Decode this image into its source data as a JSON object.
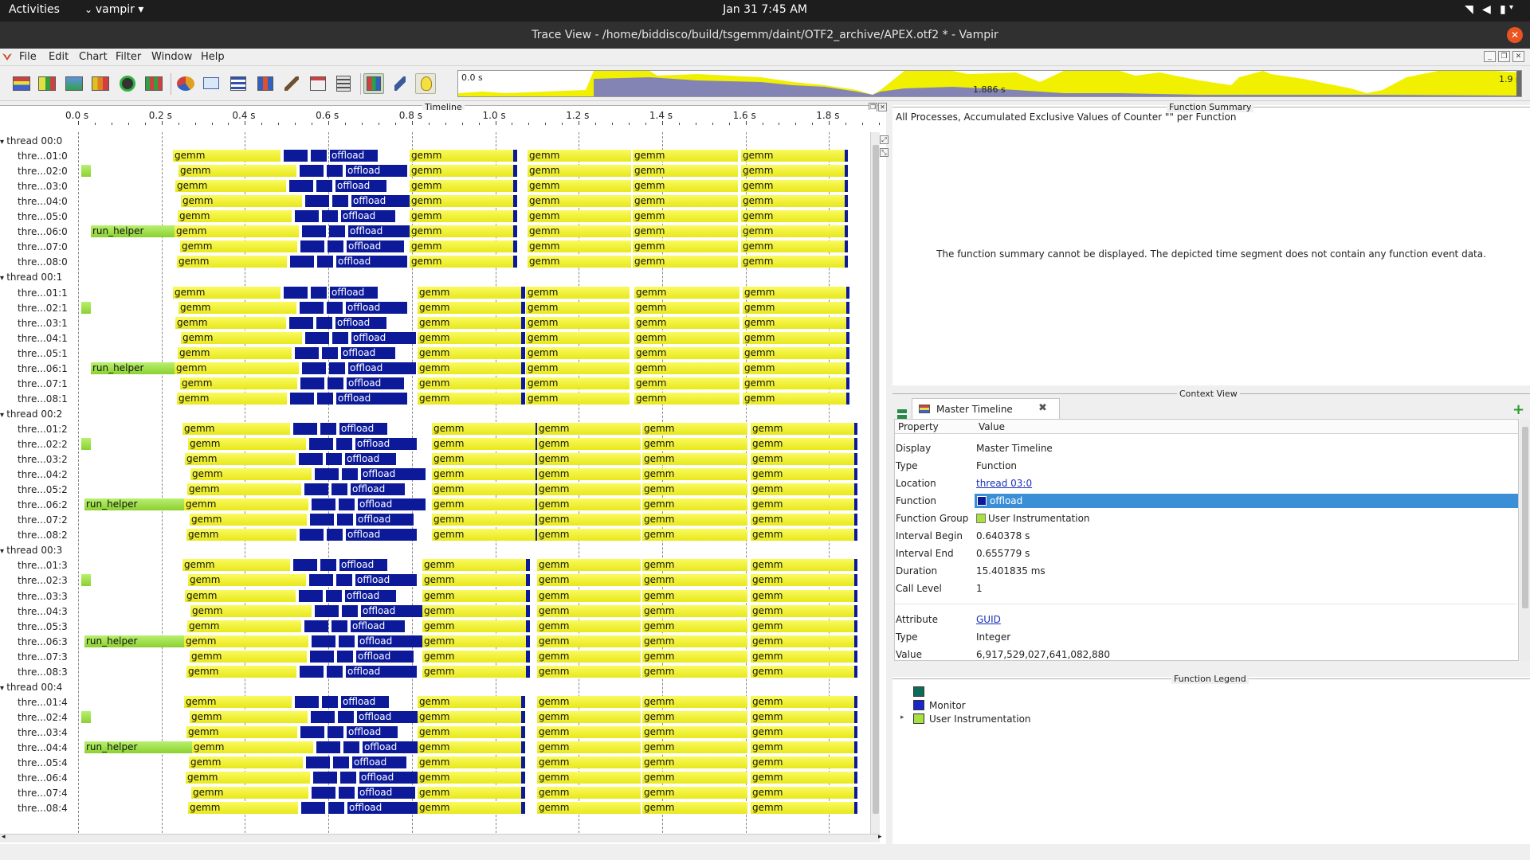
{
  "system_bar": {
    "activities": "Activities",
    "app_menu": "vampir",
    "clock": "Jan 31   7:45 AM"
  },
  "window": {
    "title": "Trace View - /home/biddisco/build/tsgemm/daint/OTF2_archive/APEX.otf2 * - Vampir"
  },
  "menu": [
    "File",
    "Edit",
    "Chart",
    "Filter",
    "Window",
    "Help"
  ],
  "overview": {
    "start": "0.0 s",
    "middle": "1.886 s",
    "end": "1.9 s"
  },
  "timeline": {
    "title": "Timeline",
    "ticks": [
      "0.0 s",
      "0.2 s",
      "0.4 s",
      "0.6 s",
      "0.8 s",
      "1.0 s",
      "1.2 s",
      "1.4 s",
      "1.6 s",
      "1.8 s"
    ],
    "groups": [
      {
        "name": "thread 00:0",
        "rows": [
          "thre...01:0",
          "thre...02:0",
          "thre...03:0",
          "thre...04:0",
          "thre...05:0",
          "thre...06:0",
          "thre...07:0",
          "thre...08:0"
        ]
      },
      {
        "name": "thread 00:1",
        "rows": [
          "thre...01:1",
          "thre...02:1",
          "thre...03:1",
          "thre...04:1",
          "thre...05:1",
          "thre...06:1",
          "thre...07:1",
          "thre...08:1"
        ]
      },
      {
        "name": "thread 00:2",
        "rows": [
          "thre...01:2",
          "thre...02:2",
          "thre...03:2",
          "thre...04:2",
          "thre...05:2",
          "thre...06:2",
          "thre...07:2",
          "thre...08:2"
        ]
      },
      {
        "name": "thread 00:3",
        "rows": [
          "thre...01:3",
          "thre...02:3",
          "thre...03:3",
          "thre...04:3",
          "thre...05:3",
          "thre...06:3",
          "thre...07:3",
          "thre...08:3"
        ]
      },
      {
        "name": "thread 00:4",
        "rows": [
          "thre...01:4",
          "thre...02:4",
          "thre...03:4",
          "thre...04:4",
          "thre...05:4",
          "thre...06:4",
          "thre...07:4",
          "thre...08:4"
        ]
      }
    ],
    "labels": {
      "gemm": "gemm",
      "offload": "offload",
      "run_helper": "run_helper"
    }
  },
  "function_summary": {
    "title": "Function Summary",
    "subtitle": "All Processes, Accumulated Exclusive Values of Counter \"\" per Function",
    "message": "The function summary cannot be displayed. The depicted time segment does not contain any function event data."
  },
  "context_view": {
    "title": "Context View",
    "tab": "Master Timeline",
    "headers": [
      "Property",
      "Value"
    ],
    "rows": [
      {
        "property": "Display",
        "value": "Master Timeline"
      },
      {
        "property": "Type",
        "value": "Function"
      },
      {
        "property": "Location",
        "value": "thread 03:0"
      },
      {
        "property": "Function",
        "value": "offload"
      },
      {
        "property": "Function Group",
        "value": "User Instrumentation"
      },
      {
        "property": "Interval Begin",
        "value": "0.640378 s"
      },
      {
        "property": "Interval End",
        "value": "0.655779 s"
      },
      {
        "property": "Duration",
        "value": "15.401835 ms"
      },
      {
        "property": "Call Level",
        "value": "1"
      }
    ],
    "attr_rows": [
      {
        "property": "Attribute",
        "value": "GUID"
      },
      {
        "property": "Type",
        "value": "Integer"
      },
      {
        "property": "Value",
        "value": "6,917,529,027,641,082,880"
      }
    ]
  },
  "function_legend": {
    "title": "Function Legend",
    "items": [
      {
        "name": "",
        "color": "#0d6b5a"
      },
      {
        "name": "Monitor",
        "color": "#1a26c8"
      },
      {
        "name": "User Instrumentation",
        "color": "#a8e040"
      }
    ]
  },
  "colors": {
    "gemm": "#f0f030",
    "offload": "#0c1a9a",
    "run_helper": "#9ad840",
    "selection": "#3a8fd6"
  }
}
